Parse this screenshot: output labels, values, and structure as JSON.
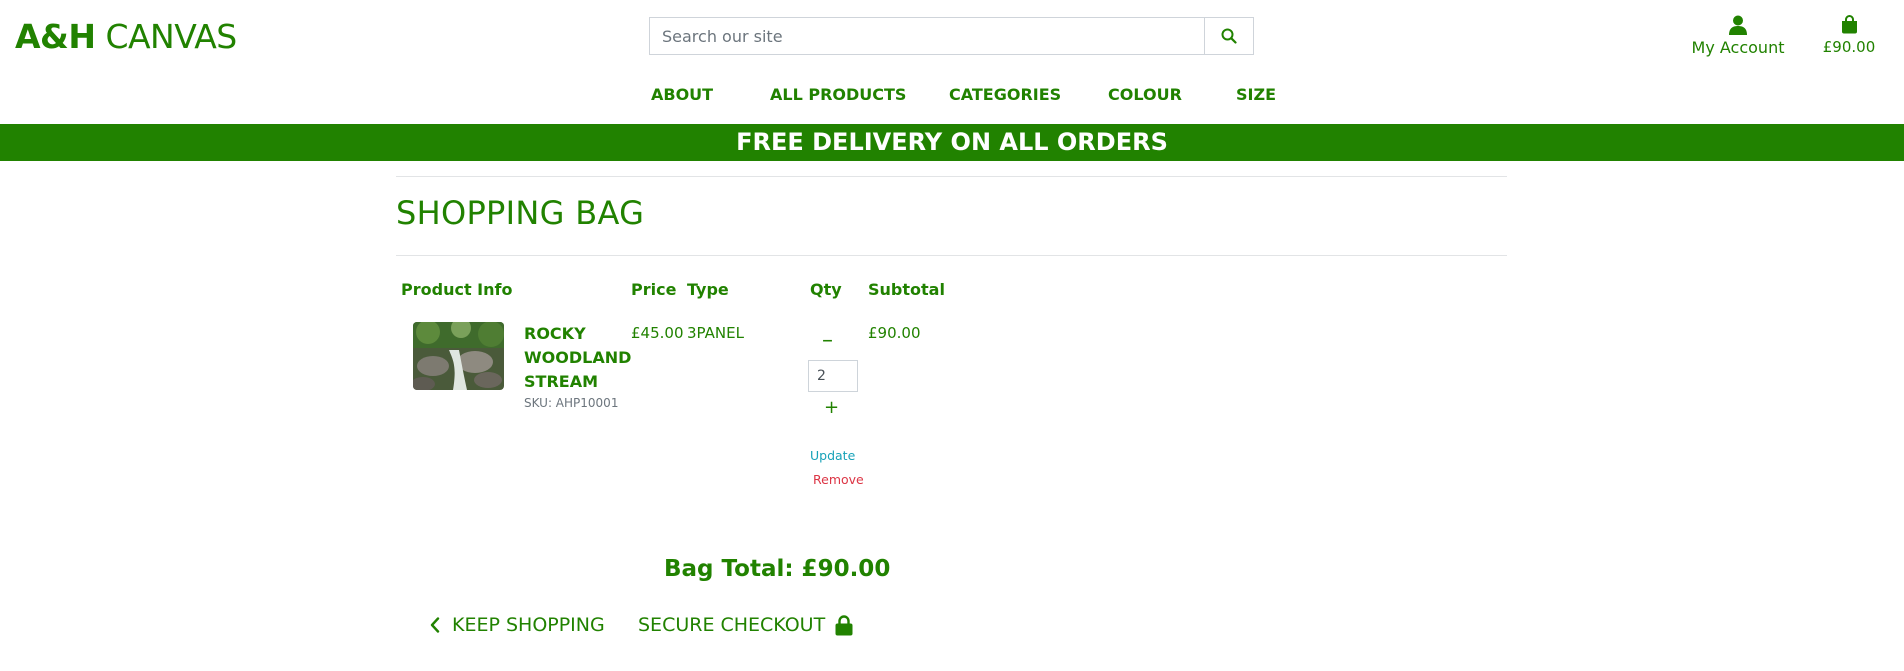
{
  "header": {
    "logo_bold": "A&H",
    "logo_light": "CANVAS",
    "search_placeholder": "Search our site",
    "account_label": "My Account",
    "bag_total": "£90.00"
  },
  "nav": {
    "items": [
      "ABOUT",
      "ALL PRODUCTS",
      "CATEGORIES",
      "COLOUR",
      "SIZE"
    ]
  },
  "banner": "FREE DELIVERY ON ALL ORDERS",
  "page_title": "SHOPPING BAG",
  "table": {
    "headers": {
      "product_info": "Product Info",
      "price": "Price",
      "type": "Type",
      "qty": "Qty",
      "subtotal": "Subtotal"
    },
    "rows": [
      {
        "name": "ROCKY WOODLAND STREAM",
        "sku": "SKU: AHP10001",
        "price": "£45.00",
        "type": "3PANEL",
        "qty": "2",
        "minus_label": "–",
        "plus_label": "+",
        "update_label": "Update",
        "remove_label": "Remove",
        "subtotal": "£90.00"
      }
    ]
  },
  "bag_total_label": "Bag Total: £90.00",
  "actions": {
    "keep_shopping": "KEEP SHOPPING",
    "secure_checkout": "SECURE CHECKOUT"
  },
  "colors": {
    "brand_green": "#218200",
    "update_link": "#17a2b8",
    "remove_link": "#dc3545"
  },
  "icons": {
    "search": "search-icon",
    "account": "user-icon",
    "bag": "shopping-bag-icon",
    "back": "chevron-left-icon",
    "lock": "lock-icon"
  }
}
